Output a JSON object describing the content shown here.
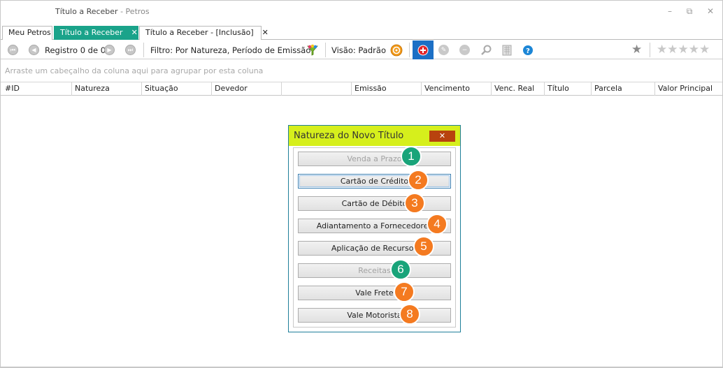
{
  "window": {
    "title": "Título a Receber",
    "app_suffix": "- Petros",
    "controls": {
      "minimize": "–",
      "restore": "⧉",
      "close": "✕"
    }
  },
  "tabs": [
    {
      "label": "Meu Petros"
    },
    {
      "label": "Título a Receber",
      "close": "✕"
    },
    {
      "label": "Título a Receber - [Inclusão]",
      "close": "✕"
    }
  ],
  "toolbar": {
    "record_label": "Registro 0 de 0",
    "filter_label": "Filtro: Por Natureza, Período de Emissão",
    "view_label": "Visão: Padrão",
    "nav_icons": [
      "first-icon",
      "prev-icon",
      "next-icon",
      "last-icon"
    ],
    "star_filled": "★",
    "star_empty": "★"
  },
  "group_panel": {
    "hint": "Arraste um cabeçalho da coluna aqui para agrupar por esta coluna"
  },
  "columns": [
    "#ID",
    "Natureza",
    "Situação",
    "Devedor",
    "",
    "Emissão",
    "Vencimento",
    "Venc. Real",
    "Título",
    "Parcela",
    "Valor Principal"
  ],
  "dialog": {
    "title": "Natureza do Novo Título",
    "close": "✕",
    "options": [
      {
        "label": "Venda a Prazo",
        "badge": "1",
        "badge_color": "#19a47a",
        "enabled": false
      },
      {
        "label": "Cartão de Crédito",
        "badge": "2",
        "badge_color": "#f47a20",
        "enabled": true
      },
      {
        "label": "Cartão de Débito",
        "badge": "3",
        "badge_color": "#f47a20",
        "enabled": true
      },
      {
        "label": "Adiantamento a Fornecedores",
        "badge": "4",
        "badge_color": "#f47a20",
        "enabled": true
      },
      {
        "label": "Aplicação de Recursos",
        "badge": "5",
        "badge_color": "#f47a20",
        "enabled": true
      },
      {
        "label": "Receitas",
        "badge": "6",
        "badge_color": "#19a47a",
        "enabled": false
      },
      {
        "label": "Vale Frete",
        "badge": "7",
        "badge_color": "#f47a20",
        "enabled": true
      },
      {
        "label": "Vale Motorista",
        "badge": "8",
        "badge_color": "#f47a20",
        "enabled": true
      }
    ]
  },
  "colors": {
    "accent_tab": "#1aa38a",
    "dialog_header": "#d6ef1c",
    "dialog_close": "#b8430e",
    "add_button": "#1c6fc5"
  }
}
